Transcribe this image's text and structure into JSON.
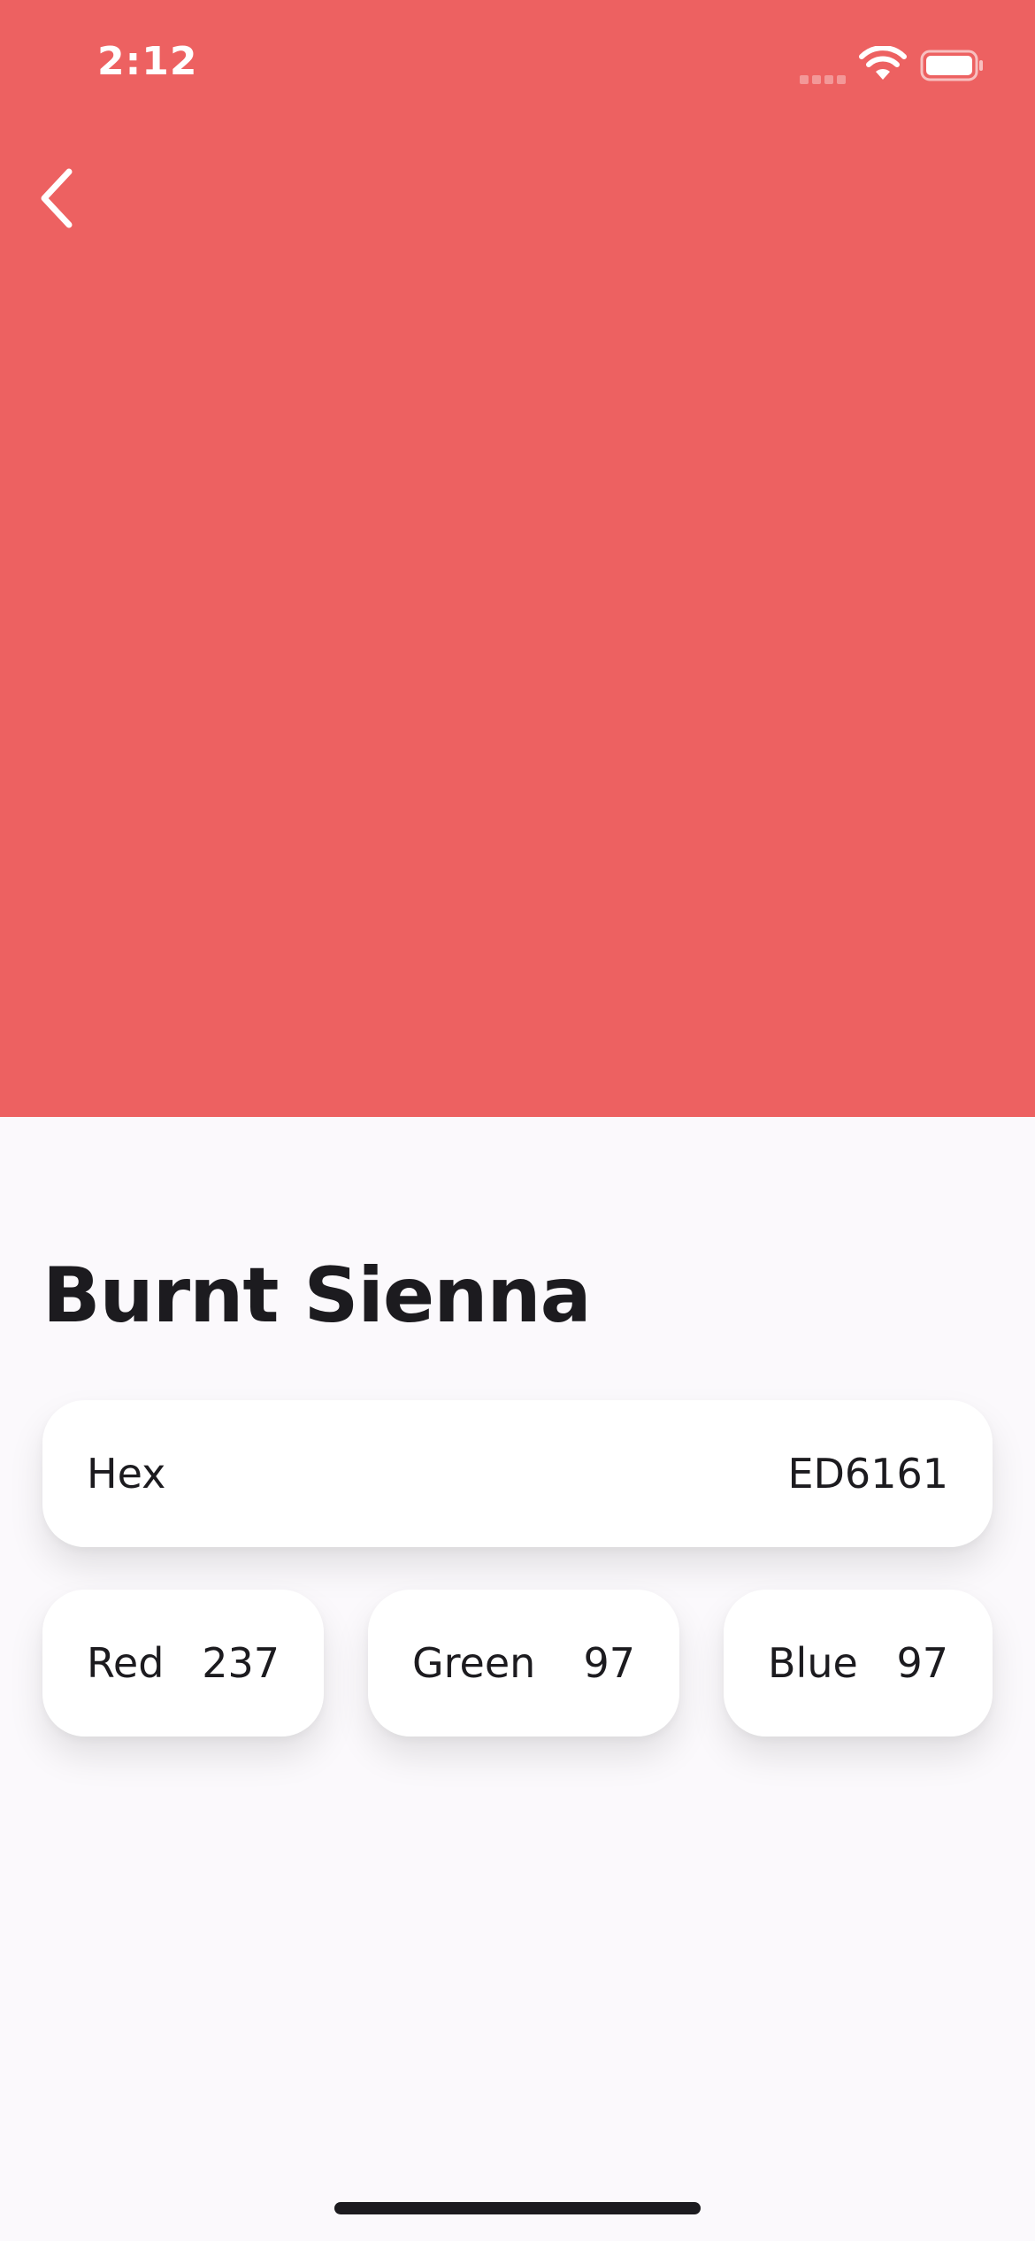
{
  "status_bar": {
    "time": "2:12"
  },
  "colors": {
    "swatch": "#ED6161",
    "background": "#FBF9FC",
    "card": "#FFFFFF",
    "text": "#1C1B1F"
  },
  "nav": {
    "back_icon": "chevron-left-icon"
  },
  "color": {
    "name": "Burnt Sienna",
    "hex_label": "Hex",
    "hex_value": "ED6161",
    "red_label": "Red",
    "red_value": "237",
    "green_label": "Green",
    "green_value": "97",
    "blue_label": "Blue",
    "blue_value": "97"
  }
}
